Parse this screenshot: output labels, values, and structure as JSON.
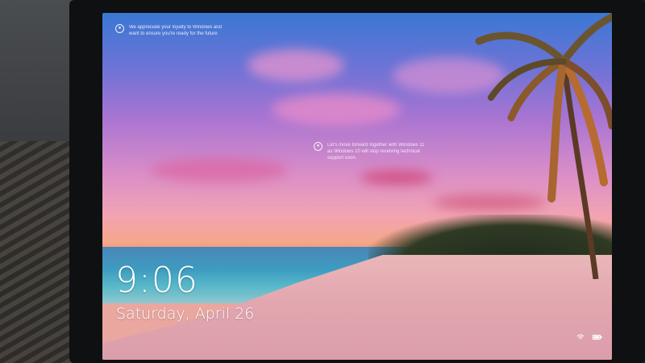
{
  "lock_screen": {
    "time": "9:06",
    "date": "Saturday, April 26",
    "notifications": [
      {
        "icon": "windows-update-icon",
        "text": "We appreciate your loyalty to Windows and want to ensure you're ready for the future"
      },
      {
        "icon": "windows-update-icon",
        "text": "Let's move forward together with Windows 11 as Windows 10 will stop receiving technical support soon."
      }
    ],
    "status_icons": [
      "network-icon",
      "battery-icon"
    ]
  }
}
